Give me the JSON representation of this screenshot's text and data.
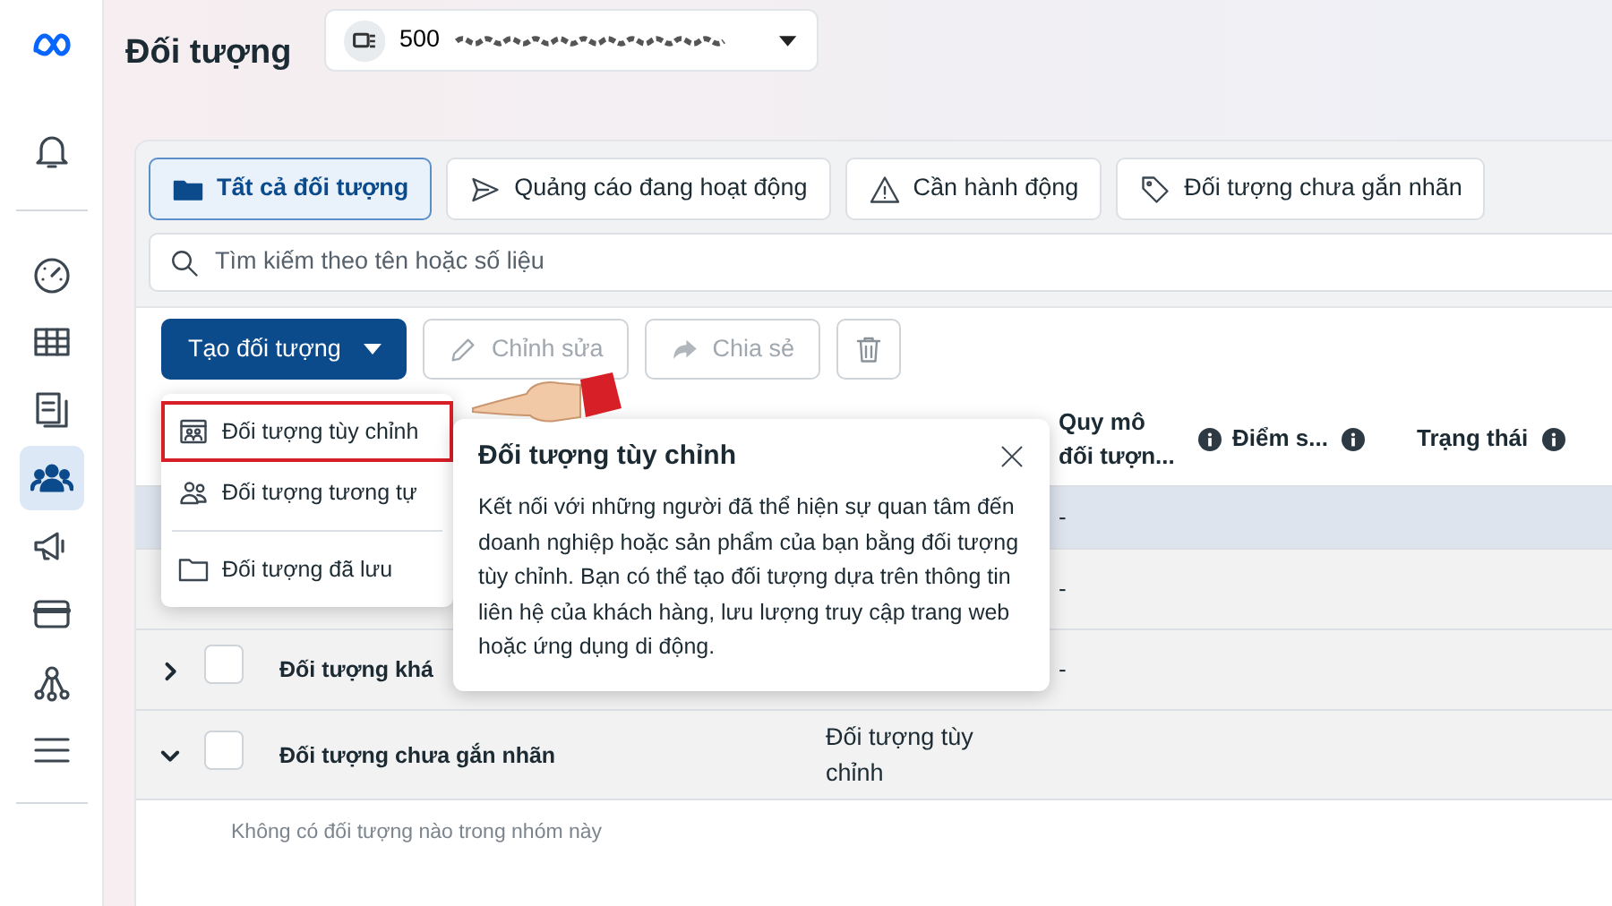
{
  "sidebar": {
    "groups": [
      [
        {
          "kind": "logo",
          "selected": false
        },
        {
          "kind": "bell",
          "selected": false
        }
      ],
      [
        {
          "kind": "gauge",
          "selected": false
        },
        {
          "kind": "table",
          "selected": false
        },
        {
          "kind": "pages",
          "selected": false
        },
        {
          "kind": "people",
          "selected": true
        },
        {
          "kind": "megaphone",
          "selected": false
        },
        {
          "kind": "card",
          "selected": false
        },
        {
          "kind": "network",
          "selected": false
        },
        {
          "kind": "menu",
          "selected": false
        }
      ]
    ]
  },
  "header": {
    "title": "Đối tượng",
    "account": "500"
  },
  "tabs": [
    {
      "label": "Tất cả đối tượng",
      "kind": "folder",
      "selected": true
    },
    {
      "label": "Quảng cáo đang hoạt động",
      "kind": "send",
      "selected": false
    },
    {
      "label": "Cần hành động",
      "kind": "warning",
      "selected": false
    },
    {
      "label": "Đối tượng chưa gắn nhãn",
      "kind": "tag",
      "selected": false
    }
  ],
  "search": {
    "placeholder": "Tìm kiếm theo tên hoặc số liệu"
  },
  "toolbar": {
    "create": "Tạo đối tượng",
    "edit": {
      "label": "Chỉnh sửa",
      "disabled": true
    },
    "share": {
      "label": "Chia sẻ",
      "disabled": true
    }
  },
  "table": {
    "columns": [
      {
        "label": "Quy mô đối tượn...",
        "info": true
      },
      {
        "label": "Điểm s...",
        "info": true
      },
      {
        "label": "Trạng thái",
        "info": true
      }
    ],
    "rows": [
      {
        "selected": true,
        "size": "-"
      },
      {
        "selected": false,
        "size": "-"
      },
      {
        "selected": false,
        "expanded": false,
        "name": "Đối tượng khá",
        "size": "-"
      },
      {
        "selected": false,
        "expanded": true,
        "name": "Đối tượng chưa gắn nhãn",
        "type": "Đối tượng tùy chỉnh"
      }
    ],
    "empty_note": "Không có đối tượng nào trong nhóm này"
  },
  "menu": {
    "items": [
      {
        "label": "Đối tượng tùy chỉnh",
        "kind": "custom",
        "selected": true,
        "separated": false
      },
      {
        "label": "Đối tượng tương tự",
        "kind": "lookalike",
        "selected": false,
        "separated": false
      },
      {
        "label": "Đối tượng đã lưu",
        "kind": "saved",
        "selected": false,
        "separated": true
      }
    ]
  },
  "tooltip": {
    "title": "Đối tượng tùy chỉnh",
    "body": "Kết nối với những người đã thể hiện sự quan tâm đến doanh nghiệp hoặc sản phẩm của bạn bằng đối tượng tùy chỉnh. Bạn có thể tạo đối tượng dựa trên thông tin liên hệ của khách hàng, lưu lượng truy cập trang web hoặc ứng dụng di động."
  }
}
